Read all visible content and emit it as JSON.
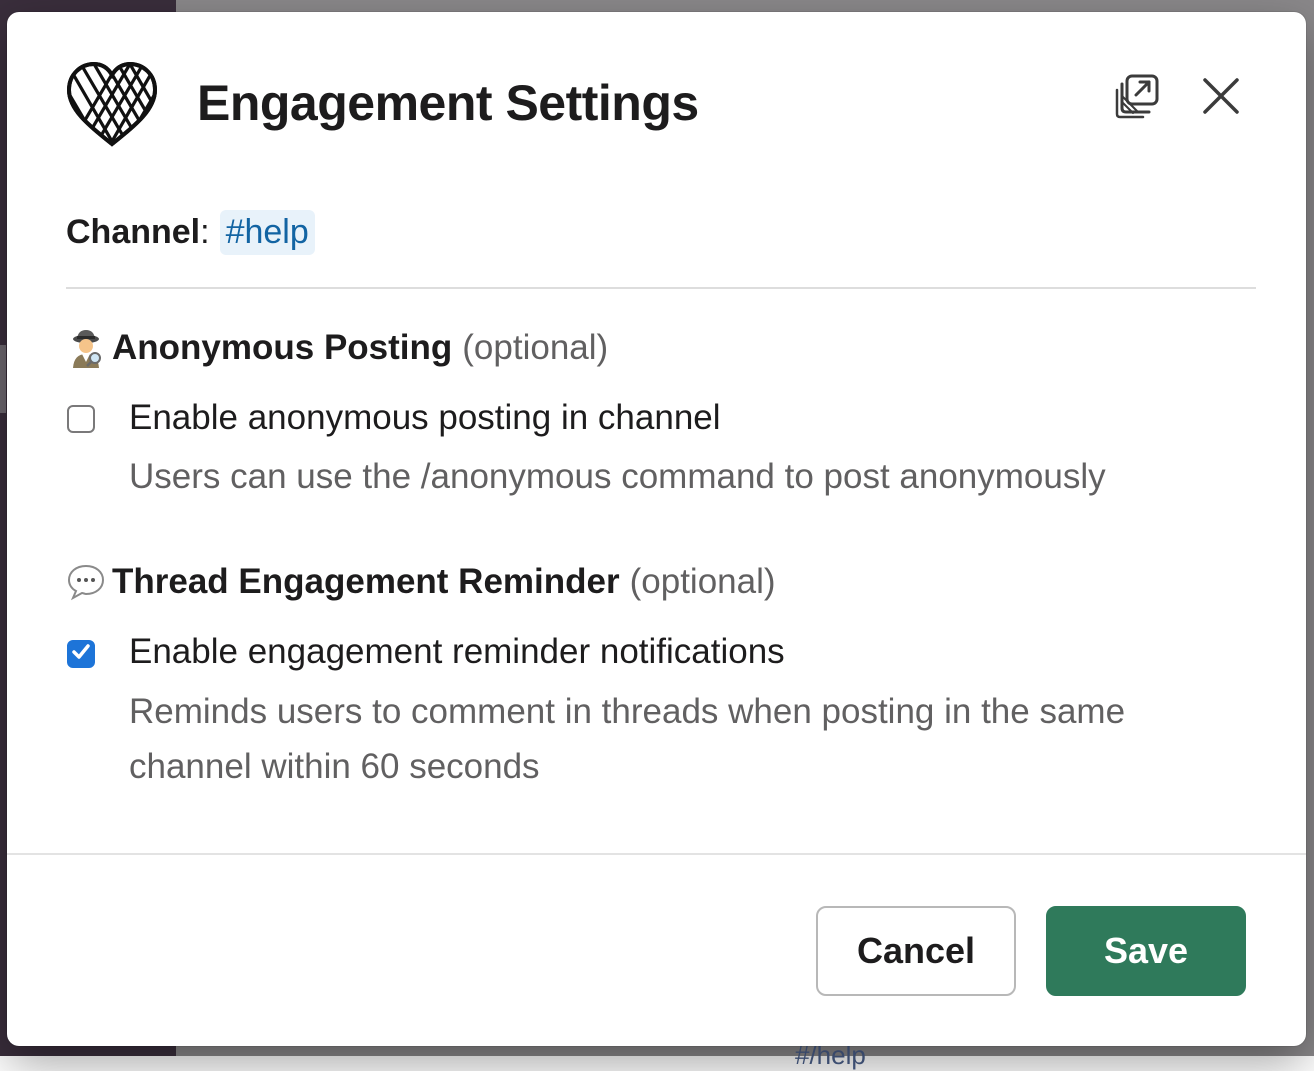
{
  "modal": {
    "title": "Engagement Settings",
    "app_icon": "rope-heart-icon",
    "popout_icon": "popout-window-icon",
    "close_icon": "close-icon"
  },
  "channel": {
    "label": "Channel",
    "separator": ":",
    "value": "#help"
  },
  "sections": [
    {
      "emoji": "detective-emoji-icon",
      "title": "Anonymous Posting",
      "optional": "(optional)",
      "option": {
        "label": "Enable anonymous posting in channel",
        "description": "Users can use the /anonymous command to post anonymously",
        "checked": false
      }
    },
    {
      "emoji": "speech-bubble-emoji-icon",
      "title": "Thread Engagement Reminder",
      "optional": "(optional)",
      "option": {
        "label": "Enable engagement reminder notifications",
        "description": "Reminds users to comment in threads when posting in the same channel within 60 seconds",
        "checked": true
      }
    }
  ],
  "footer": {
    "cancel_label": "Cancel",
    "save_label": "Save"
  },
  "background_hint": "#/help",
  "colors": {
    "primary_button": "#2f7a5b",
    "checkbox_checked": "#1d74d8",
    "channel_link": "#1264a3",
    "channel_chip_bg": "#e8f2fa"
  }
}
